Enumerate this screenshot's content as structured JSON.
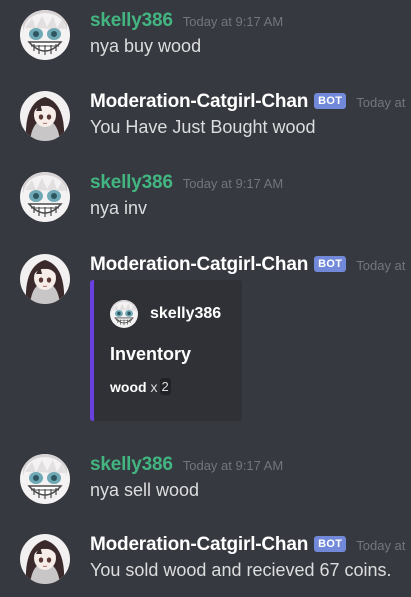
{
  "colors": {
    "background": "#36393f",
    "user_name": "#43b581",
    "bot_name": "#ffffff",
    "bot_tag": "#7289da",
    "timestamp": "#72767d",
    "embed_background": "#2f3136",
    "embed_accent": "#6a40e0"
  },
  "messages": [
    {
      "author": "skelly386",
      "timestamp": "Today at 9:17 AM",
      "text": "nya buy wood"
    },
    {
      "author": "Moderation-Catgirl-Chan",
      "bot_tag": "BOT",
      "timestamp": "Today at",
      "text": "You Have Just Bought wood"
    },
    {
      "author": "skelly386",
      "timestamp": "Today at 9:17 AM",
      "text": "nya inv"
    },
    {
      "author": "Moderation-Catgirl-Chan",
      "bot_tag": "BOT",
      "timestamp": "Today at",
      "embed": {
        "author": "skelly386",
        "title": "Inventory",
        "field_name": "wood",
        "field_x": "x",
        "field_qty": "2"
      }
    },
    {
      "author": "skelly386",
      "timestamp": "Today at 9:17 AM",
      "text": "nya sell wood"
    },
    {
      "author": "Moderation-Catgirl-Chan",
      "bot_tag": "BOT",
      "timestamp": "Today at",
      "text": "You sold wood and recieved 67 coins."
    }
  ]
}
